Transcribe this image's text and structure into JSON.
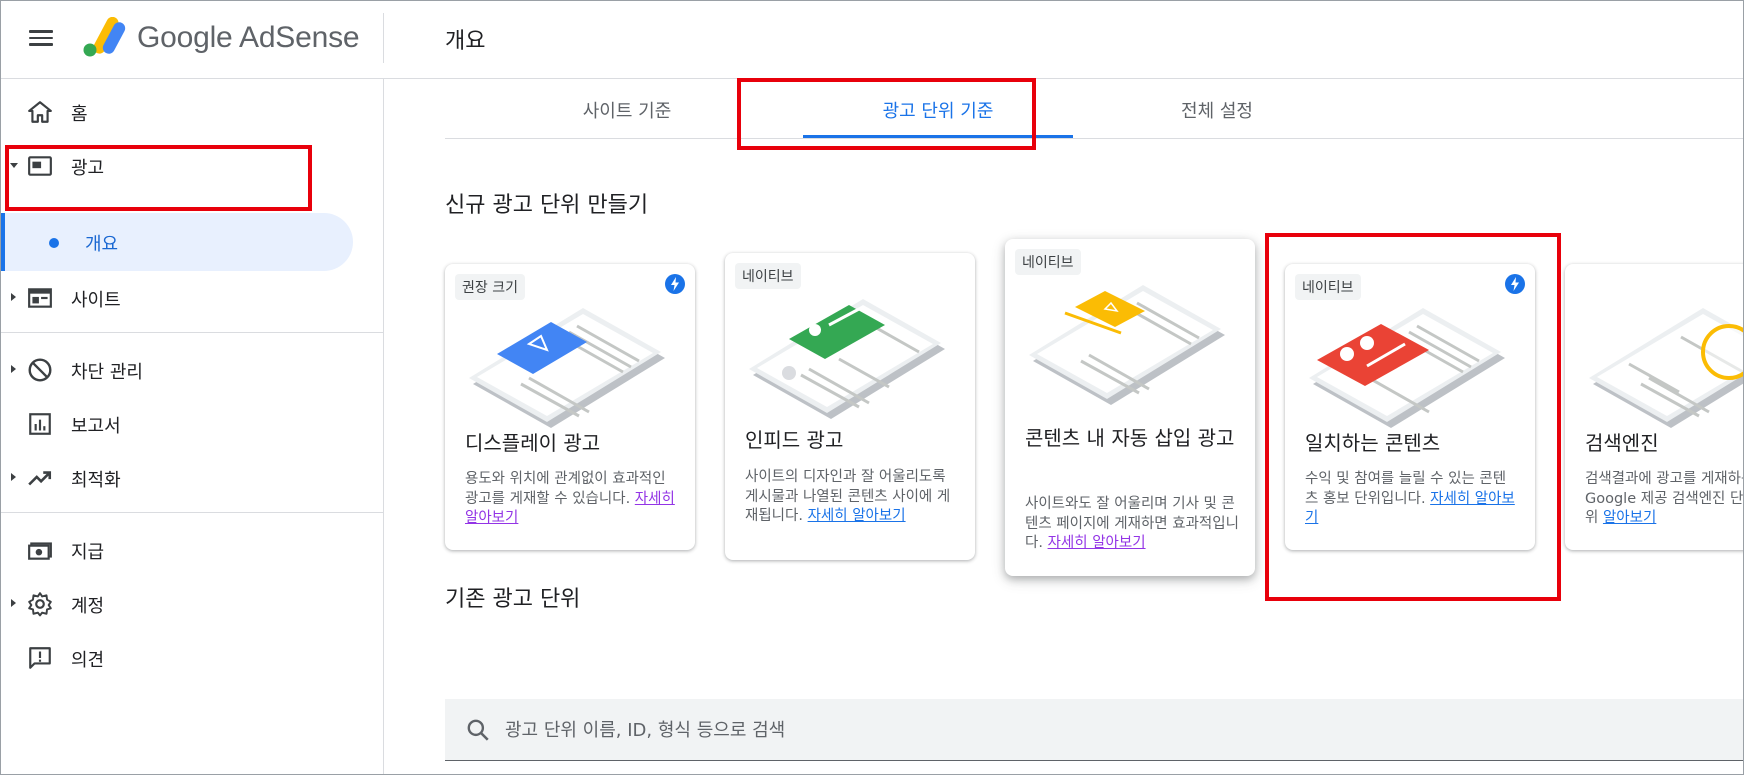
{
  "header": {
    "brand": "Google AdSense",
    "page_title": "개요"
  },
  "sidebar": {
    "items": [
      {
        "label": "홈",
        "icon": "home-icon"
      },
      {
        "label": "광고",
        "icon": "ads-icon"
      },
      {
        "label": "개요",
        "icon": "dot-icon"
      },
      {
        "label": "사이트",
        "icon": "sites-icon"
      },
      {
        "label": "차단 관리",
        "icon": "block-icon"
      },
      {
        "label": "보고서",
        "icon": "reports-icon"
      },
      {
        "label": "최적화",
        "icon": "optimization-icon"
      },
      {
        "label": "지급",
        "icon": "payments-icon"
      },
      {
        "label": "계정",
        "icon": "account-gear-icon"
      },
      {
        "label": "의견",
        "icon": "feedback-icon"
      }
    ]
  },
  "tabs": [
    {
      "label": "사이트 기준"
    },
    {
      "label": "광고 단위 기준"
    },
    {
      "label": "전체 설정"
    }
  ],
  "new_section_title": "신규 광고 단위 만들기",
  "cards": [
    {
      "tag": "권장 크기",
      "title": "디스플레이 광고",
      "desc": "용도와 위치에 관계없이 효과적인 광고를 게재할 수 있습니다.",
      "link": "자세히 알아보기"
    },
    {
      "tag": "네이티브",
      "title": "인피드 광고",
      "desc": "사이트의 디자인과 잘 어울리도록 게시물과 나열된 콘텐츠 사이에 게재됩니다.",
      "link": "자세히 알아보기"
    },
    {
      "tag": "네이티브",
      "title": "콘텐츠 내 자동 삽입 광고",
      "desc": "사이트와도 잘 어울리며 기사 및 콘텐츠 페이지에 게재하면 효과적입니다.",
      "link": "자세히 알아보기"
    },
    {
      "tag": "네이티브",
      "title": "일치하는 콘텐츠",
      "desc": "수익 및 참여를 늘릴 수 있는 콘텐츠 홍보 단위입니다.",
      "link": "자세히 알아보기"
    },
    {
      "tag": "",
      "title": "검색엔진",
      "desc": "검색결과에 광고를 게재하는 Google 제공 검색엔진 단위",
      "link": "알아보기"
    }
  ],
  "existing_section_title": "기존 광고 단위",
  "search": {
    "placeholder": "광고 단위 이름, ID, 형식 등으로 검색"
  },
  "colors": {
    "accent": "#1a73e8",
    "highlight": "#e8000b",
    "display_ad": "#4285f4",
    "in_feed": "#34a853",
    "in_article": "#fbbc04",
    "matched_content": "#ea4335"
  }
}
